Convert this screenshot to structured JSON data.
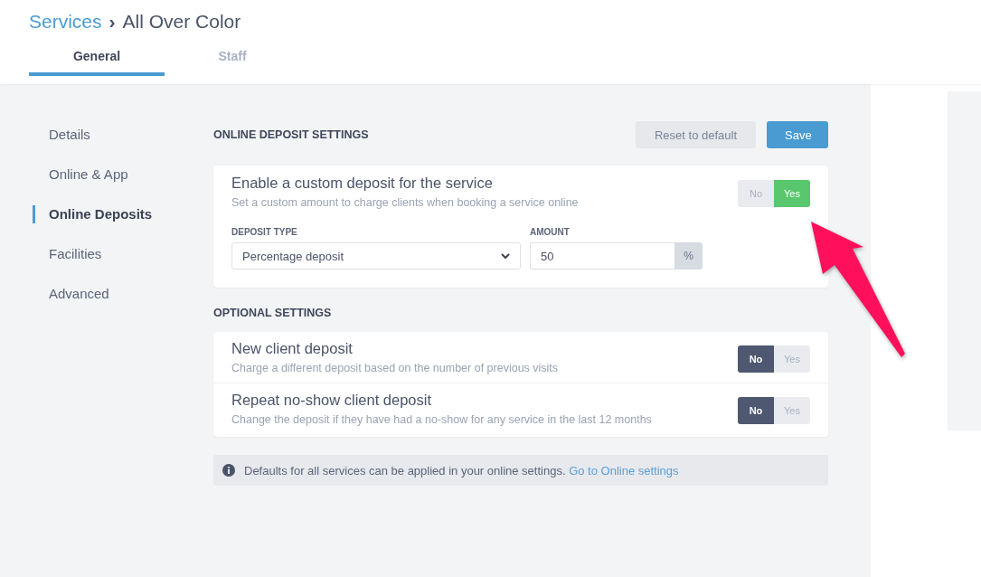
{
  "breadcrumb": {
    "parent": "Services",
    "separator": "›",
    "current": "All Over Color"
  },
  "tabs": [
    {
      "label": "General",
      "selected": true
    },
    {
      "label": "Staff",
      "selected": false
    }
  ],
  "sidebar": {
    "items": [
      {
        "label": "Details",
        "selected": false
      },
      {
        "label": "Online & App",
        "selected": false
      },
      {
        "label": "Online Deposits",
        "selected": true
      },
      {
        "label": "Facilities",
        "selected": false
      },
      {
        "label": "Advanced",
        "selected": false
      }
    ]
  },
  "online_deposit": {
    "heading": "ONLINE DEPOSIT SETTINGS",
    "reset_button": "Reset to default",
    "save_button": "Save",
    "setting": {
      "title": "Enable a custom deposit for the service",
      "description": "Set a custom amount to charge clients when booking a service online",
      "no_label": "No",
      "yes_label": "Yes",
      "on": true
    },
    "deposit_type": {
      "label": "DEPOSIT TYPE",
      "value": "Percentage deposit"
    },
    "amount": {
      "label": "AMOUNT",
      "value": "50",
      "unit": "%"
    }
  },
  "optional": {
    "heading": "OPTIONAL SETTINGS",
    "settings": [
      {
        "title": "New client deposit",
        "description": "Charge a different deposit based on the number of previous visits",
        "no_label": "No",
        "yes_label": "Yes",
        "on": false
      },
      {
        "title": "Repeat no-show client deposit",
        "description": "Change the deposit if they have had a no-show for any service in the last 12 months",
        "no_label": "No",
        "yes_label": "Yes",
        "on": false
      }
    ]
  },
  "info": {
    "text": "Defaults for all services can be applied in your online settings.",
    "link": "Go to Online settings"
  }
}
